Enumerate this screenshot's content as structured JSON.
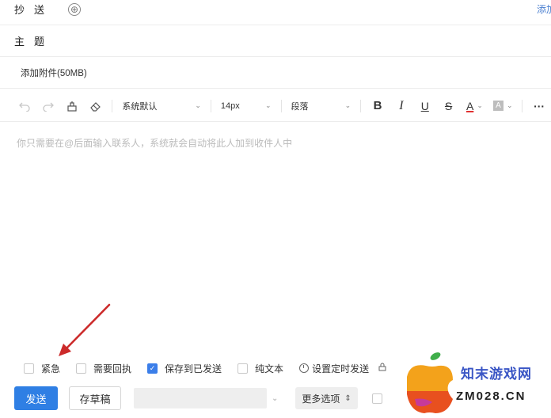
{
  "header": {
    "cc_label": "抄送",
    "add_cc_glyph": "⊕",
    "add_link": "添加",
    "subject_label": "主题"
  },
  "attachment": {
    "label": "添加附件(50MB)"
  },
  "toolbar": {
    "font_family": "系统默认",
    "font_size": "14px",
    "paragraph": "段落",
    "bold": "B",
    "italic": "I",
    "underline": "U",
    "strike": "S",
    "font_color": "A",
    "more": "···"
  },
  "editor": {
    "placeholder": "你只需要在@后面输入联系人，系统就会自动将此人加到收件人中"
  },
  "options": {
    "urgent": "紧急",
    "receipt": "需要回执",
    "save_sent": "保存到已发送",
    "plain_text": "纯文本",
    "schedule": "设置定时发送"
  },
  "actions": {
    "send": "发送",
    "draft": "存草稿",
    "more_options": "更多选项"
  },
  "watermark": {
    "cn": "知末游戏网",
    "domain": "ZM028.CN"
  },
  "colors": {
    "primary": "#2f7fe4",
    "arrow": "#cc2a2a",
    "link": "#4a7fd0"
  }
}
